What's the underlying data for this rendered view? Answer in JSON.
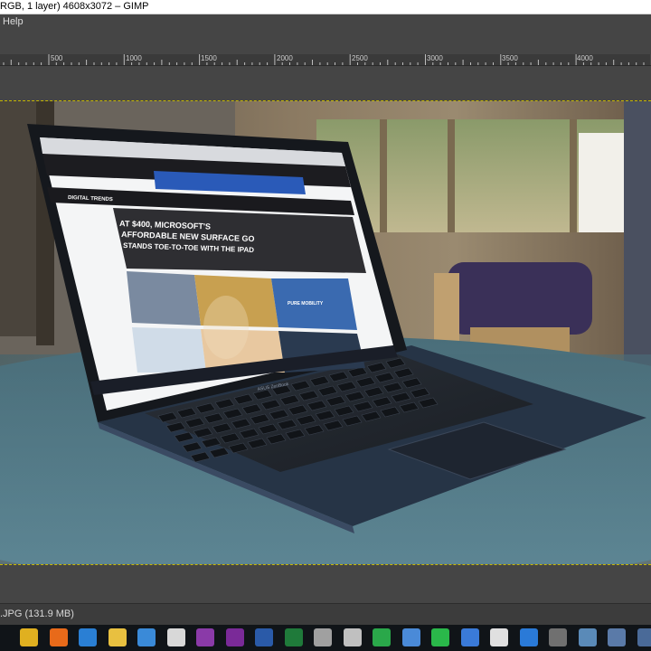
{
  "window": {
    "title": "RGB, 1 layer) 4608x3072 – GIMP"
  },
  "menubar": {
    "items": [
      "Help"
    ]
  },
  "ruler": {
    "labels": [
      "500",
      "1000",
      "1500",
      "2000",
      "2500",
      "3000",
      "3500",
      "4000"
    ]
  },
  "image": {
    "alt": "Laptop on a table showing the Digital Trends website",
    "screen_text": {
      "site": "DIGITAL TRENDS",
      "headline_1": "AT $400, MICROSOFT'S",
      "headline_2": "AFFORDABLE NEW SURFACE GO",
      "headline_3": "STANDS TOE-TO-TOE WITH THE IPAD",
      "ad": "PURE MOBILITY",
      "brand": "ASUS ZenBook"
    }
  },
  "statusbar": {
    "text": ".JPG (131.9 MB)"
  },
  "taskbar": {
    "icons": [
      {
        "name": "chrome-icon",
        "color": "#e0b020"
      },
      {
        "name": "firefox-icon",
        "color": "#e86a1a"
      },
      {
        "name": "edge-icon",
        "color": "#2a7fd4"
      },
      {
        "name": "file-explorer-icon",
        "color": "#e8c040"
      },
      {
        "name": "store-icon",
        "color": "#3a8ad8"
      },
      {
        "name": "mail-icon",
        "color": "#d8d8d8"
      },
      {
        "name": "onenote-icon",
        "color": "#8a3aa8"
      },
      {
        "name": "onenote-2-icon",
        "color": "#7a2a98"
      },
      {
        "name": "word-icon",
        "color": "#2a5aa8"
      },
      {
        "name": "excel-icon",
        "color": "#1f7a3a"
      },
      {
        "name": "app-stack-icon",
        "color": "#a0a0a0"
      },
      {
        "name": "snagit-icon",
        "color": "#c0c0c0"
      },
      {
        "name": "evernote-icon",
        "color": "#2aa84a"
      },
      {
        "name": "feather-icon",
        "color": "#4a8ad8"
      },
      {
        "name": "whatsapp-icon",
        "color": "#2ab84a"
      },
      {
        "name": "todo-icon",
        "color": "#3a7ad8"
      },
      {
        "name": "slack-icon",
        "color": "#e0e0e0"
      },
      {
        "name": "trello-icon",
        "color": "#2a7ad8"
      },
      {
        "name": "calculator-icon",
        "color": "#707070"
      },
      {
        "name": "app-1-icon",
        "color": "#5a8ab8"
      },
      {
        "name": "app-2-icon",
        "color": "#5a7aa8"
      },
      {
        "name": "app-3-icon",
        "color": "#4a6a98"
      }
    ]
  }
}
